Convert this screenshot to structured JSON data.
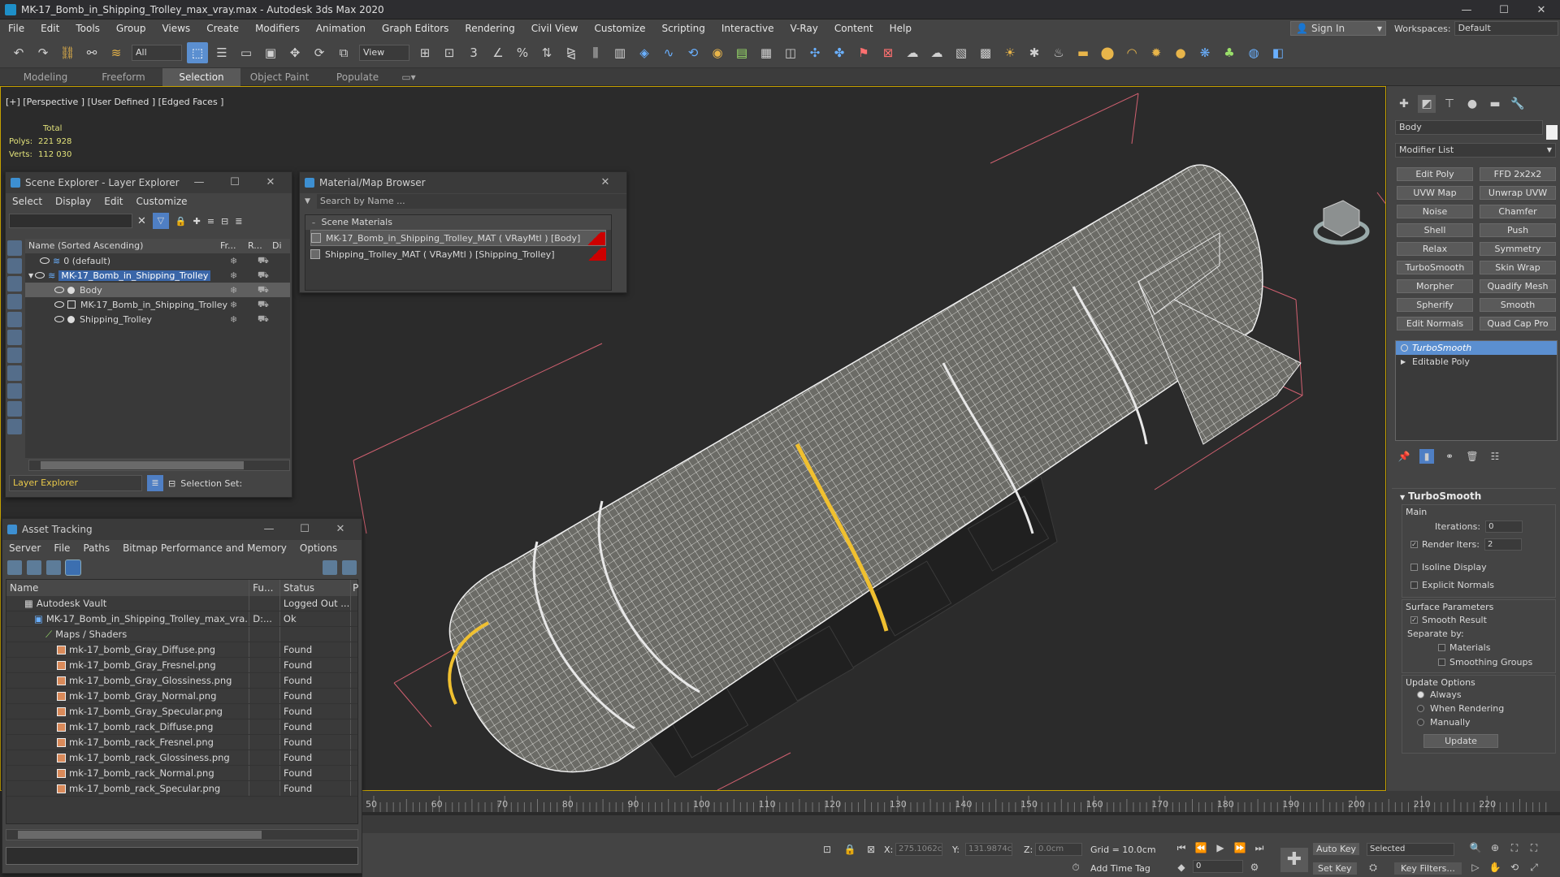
{
  "window": {
    "title": "MK-17_Bomb_in_Shipping_Trolley_max_vray.max - Autodesk 3ds Max 2020",
    "minimize": "—",
    "maximize": "☐",
    "close": "✕"
  },
  "menu": [
    "File",
    "Edit",
    "Tools",
    "Group",
    "Views",
    "Create",
    "Modifiers",
    "Animation",
    "Graph Editors",
    "Rendering",
    "Civil View",
    "Customize",
    "Scripting",
    "Interactive",
    "V-Ray",
    "Content",
    "Help"
  ],
  "account": {
    "sign_in": "Sign In",
    "workspaces_label": "Workspaces:",
    "workspace": "Default"
  },
  "toolbar": {
    "selection_filter": "All",
    "ref_coord": "View"
  },
  "ribbon_tabs": [
    "Modeling",
    "Freeform",
    "Selection",
    "Object Paint",
    "Populate"
  ],
  "ribbon_active": "Selection",
  "viewport": {
    "label": "[+] [Perspective ] [User Defined ] [Edged Faces ]",
    "stats": {
      "total": "Total",
      "polys_label": "Polys:",
      "polys": "221 928",
      "verts_label": "Verts:",
      "verts": "112 030"
    }
  },
  "scene_explorer": {
    "title": "Scene Explorer - Layer Explorer",
    "menu": [
      "Select",
      "Display",
      "Edit",
      "Customize"
    ],
    "col_name": "Name (Sorted Ascending)",
    "col_fr": "Fr...",
    "col_r": "R...",
    "col_di": "Di",
    "rows": [
      {
        "name": "0 (default)",
        "indent": 1
      },
      {
        "name": "MK-17_Bomb_in_Shipping_Trolley",
        "indent": 1
      },
      {
        "name": "Body",
        "indent": 2
      },
      {
        "name": "MK-17_Bomb_in_Shipping_Trolley",
        "indent": 2
      },
      {
        "name": "Shipping_Trolley",
        "indent": 2
      }
    ],
    "bottom_dropdown": "Layer Explorer",
    "selection_set_label": "Selection Set:"
  },
  "material_browser": {
    "title": "Material/Map Browser",
    "search_placeholder": "Search by Name ...",
    "group": "Scene Materials",
    "items": [
      "MK-17_Bomb_in_Shipping_Trolley_MAT  ( VRayMtl ) [Body]",
      "Shipping_Trolley_MAT  ( VRayMtl ) [Shipping_Trolley]"
    ]
  },
  "asset_tracking": {
    "title": "Asset Tracking",
    "menu": [
      "Server",
      "File",
      "Paths",
      "Bitmap Performance and Memory",
      "Options"
    ],
    "columns": {
      "name": "Name",
      "fu": "Fu...",
      "status": "Status",
      "p": "P"
    },
    "rows": [
      {
        "name": "Autodesk Vault",
        "fu": "",
        "status": "Logged Out ...",
        "indent": 1
      },
      {
        "name": "MK-17_Bomb_in_Shipping_Trolley_max_vra...",
        "fu": "D:...",
        "status": "Ok",
        "indent": 2
      },
      {
        "name": "Maps / Shaders",
        "fu": "",
        "status": "",
        "indent": 3
      },
      {
        "name": "mk-17_bomb_Gray_Diffuse.png",
        "fu": "",
        "status": "Found",
        "indent": 4
      },
      {
        "name": "mk-17_bomb_Gray_Fresnel.png",
        "fu": "",
        "status": "Found",
        "indent": 4
      },
      {
        "name": "mk-17_bomb_Gray_Glossiness.png",
        "fu": "",
        "status": "Found",
        "indent": 4
      },
      {
        "name": "mk-17_bomb_Gray_Normal.png",
        "fu": "",
        "status": "Found",
        "indent": 4
      },
      {
        "name": "mk-17_bomb_Gray_Specular.png",
        "fu": "",
        "status": "Found",
        "indent": 4
      },
      {
        "name": "mk-17_bomb_rack_Diffuse.png",
        "fu": "",
        "status": "Found",
        "indent": 4
      },
      {
        "name": "mk-17_bomb_rack_Fresnel.png",
        "fu": "",
        "status": "Found",
        "indent": 4
      },
      {
        "name": "mk-17_bomb_rack_Glossiness.png",
        "fu": "",
        "status": "Found",
        "indent": 4
      },
      {
        "name": "mk-17_bomb_rack_Normal.png",
        "fu": "",
        "status": "Found",
        "indent": 4
      },
      {
        "name": "mk-17_bomb_rack_Specular.png",
        "fu": "",
        "status": "Found",
        "indent": 4
      }
    ]
  },
  "command_panel": {
    "object_name": "Body",
    "modifier_list": "Modifier List",
    "modifier_buttons": [
      "Edit Poly",
      "FFD 2x2x2",
      "UVW Map",
      "Unwrap UVW",
      "Noise",
      "Chamfer",
      "Shell",
      "Push",
      "Relax",
      "Symmetry",
      "TurboSmooth",
      "Skin Wrap",
      "Morpher",
      "Quadify Mesh",
      "Spherify",
      "Smooth",
      "Edit Normals",
      "Quad Cap Pro"
    ],
    "stack": [
      "TurboSmooth",
      "Editable Poly"
    ],
    "turbosmooth": {
      "title": "TurboSmooth",
      "main": "Main",
      "iterations_label": "Iterations:",
      "iterations": "0",
      "render_iters_label": "Render Iters:",
      "render_iters": "2",
      "isoline": "Isoline Display",
      "explicit": "Explicit Normals",
      "surface": "Surface Parameters",
      "smooth_result": "Smooth Result",
      "separate_by": "Separate by:",
      "materials": "Materials",
      "smoothing_groups": "Smoothing Groups",
      "update_options": "Update Options",
      "always": "Always",
      "when_rendering": "When Rendering",
      "manually": "Manually",
      "update": "Update"
    }
  },
  "timeline": {
    "ticks": [
      "50",
      "60",
      "70",
      "80",
      "90",
      "100",
      "110",
      "120",
      "130",
      "140",
      "150",
      "160",
      "170",
      "180",
      "190",
      "200",
      "210",
      "220"
    ]
  },
  "status": {
    "x_label": "X:",
    "x": "275.1062c",
    "y_label": "Y:",
    "y": "131.9874c",
    "z_label": "Z:",
    "z": "0.0cm",
    "grid": "Grid = 10.0cm",
    "add_time_tag": "Add Time Tag",
    "auto_key": "Auto Key",
    "set_key": "Set Key",
    "selected": "Selected",
    "key_filters": "Key Filters...",
    "frame": "0"
  }
}
